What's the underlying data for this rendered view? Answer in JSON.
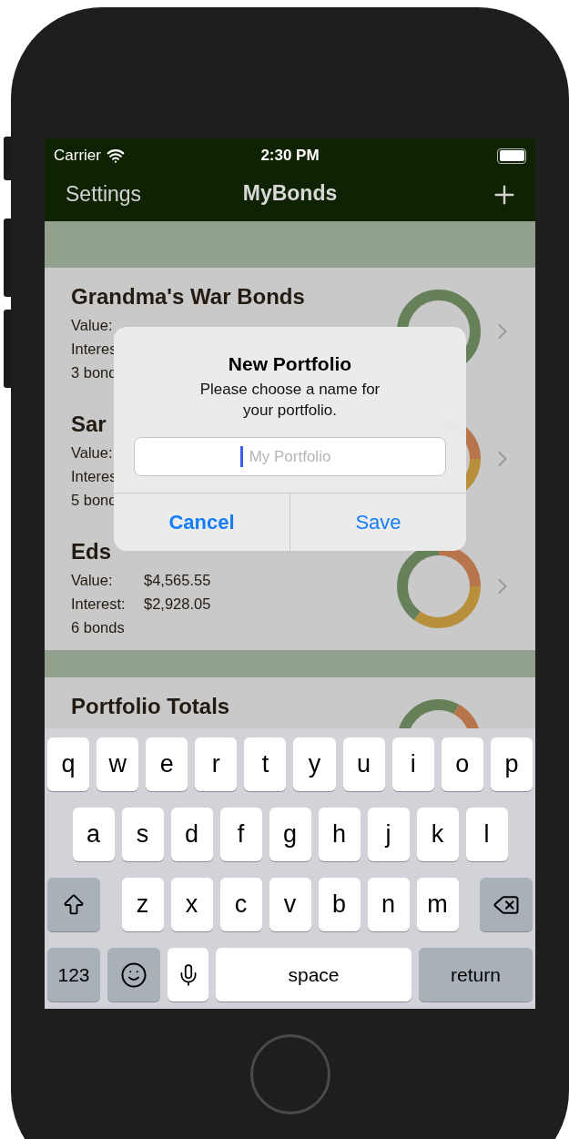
{
  "status_bar": {
    "carrier": "Carrier",
    "time": "2:30 PM"
  },
  "nav_bar": {
    "left_button": "Settings",
    "title": "MyBonds"
  },
  "portfolios": [
    {
      "name": "Grandma's War Bonds",
      "lines": [
        {
          "label": "Value:"
        },
        {
          "label": "Interes"
        },
        {
          "label": "3 bond"
        }
      ]
    },
    {
      "name": "Sar",
      "lines": [
        {
          "label": "Value:"
        },
        {
          "label": "Interes"
        },
        {
          "label": "5 bond"
        }
      ]
    },
    {
      "name": "Eds",
      "lines": [
        {
          "label": "Value:",
          "value": "$4,565.55"
        },
        {
          "label": "Interest:",
          "value": "$2,928.05"
        },
        {
          "label": "6 bonds"
        }
      ]
    }
  ],
  "totals": {
    "title": "Portfolio Totals"
  },
  "dialog": {
    "title": "New Portfolio",
    "message": "Please choose a name for your portfolio.",
    "field": {
      "placeholder": "My Portfolio",
      "focused": true
    },
    "buttons": [
      {
        "label": "Cancel",
        "kind": "cancel"
      },
      {
        "label": "Save",
        "kind": "default"
      }
    ]
  },
  "keyboard": {
    "rows": [
      {
        "keys": [
          {
            "kind": "letter",
            "label": "q"
          },
          {
            "kind": "letter",
            "label": "w"
          },
          {
            "kind": "letter",
            "label": "e"
          },
          {
            "kind": "letter",
            "label": "r"
          },
          {
            "kind": "letter",
            "label": "t"
          },
          {
            "kind": "letter",
            "label": "y"
          },
          {
            "kind": "letter",
            "label": "u"
          },
          {
            "kind": "letter",
            "label": "i"
          },
          {
            "kind": "letter",
            "label": "o"
          },
          {
            "kind": "letter",
            "label": "p"
          }
        ]
      },
      {
        "keys": [
          {
            "kind": "letter",
            "label": "a"
          },
          {
            "kind": "letter",
            "label": "s"
          },
          {
            "kind": "letter",
            "label": "d"
          },
          {
            "kind": "letter",
            "label": "f"
          },
          {
            "kind": "letter",
            "label": "g"
          },
          {
            "kind": "letter",
            "label": "h"
          },
          {
            "kind": "letter",
            "label": "j"
          },
          {
            "kind": "letter",
            "label": "k"
          },
          {
            "kind": "letter",
            "label": "l"
          }
        ]
      },
      {
        "keys": [
          {
            "kind": "shift"
          },
          {
            "kind": "letter",
            "label": "z"
          },
          {
            "kind": "letter",
            "label": "x"
          },
          {
            "kind": "letter",
            "label": "c"
          },
          {
            "kind": "letter",
            "label": "v"
          },
          {
            "kind": "letter",
            "label": "b"
          },
          {
            "kind": "letter",
            "label": "n"
          },
          {
            "kind": "letter",
            "label": "m"
          },
          {
            "kind": "delete"
          }
        ]
      },
      {
        "keys": [
          {
            "kind": "numbers",
            "label": "123"
          },
          {
            "kind": "emoji"
          },
          {
            "kind": "mic"
          },
          {
            "kind": "space",
            "label": "space"
          },
          {
            "kind": "return",
            "label": "return"
          }
        ]
      }
    ]
  }
}
